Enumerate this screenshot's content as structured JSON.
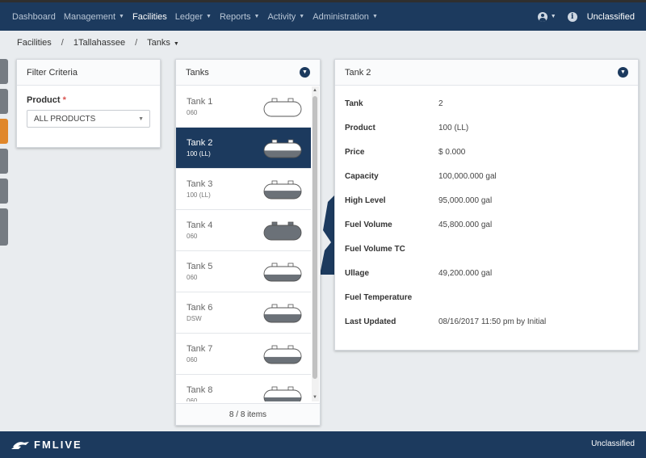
{
  "nav": {
    "items": [
      {
        "label": "Dashboard",
        "has_menu": false,
        "active": false
      },
      {
        "label": "Management",
        "has_menu": true,
        "active": false
      },
      {
        "label": "Facilities",
        "has_menu": false,
        "active": true
      },
      {
        "label": "Ledger",
        "has_menu": true,
        "active": false
      },
      {
        "label": "Reports",
        "has_menu": true,
        "active": false
      },
      {
        "label": "Activity",
        "has_menu": true,
        "active": false
      },
      {
        "label": "Administration",
        "has_menu": true,
        "active": false
      }
    ],
    "classification": "Unclassified"
  },
  "breadcrumb": {
    "items": [
      "Facilities",
      "1Tallahassee",
      "Tanks"
    ]
  },
  "filter": {
    "title": "Filter Criteria",
    "product_label": "Product",
    "required_mark": "*",
    "product_value": "ALL PRODUCTS"
  },
  "tanks": {
    "title": "Tanks",
    "items": [
      {
        "name": "Tank 1",
        "product": "060",
        "fill": 0.0,
        "selected": false
      },
      {
        "name": "Tank 2",
        "product": "100 (LL)",
        "fill": 0.48,
        "selected": true
      },
      {
        "name": "Tank 3",
        "product": "100 (LL)",
        "fill": 0.55,
        "selected": false
      },
      {
        "name": "Tank 4",
        "product": "060",
        "fill": 1.0,
        "selected": false
      },
      {
        "name": "Tank 5",
        "product": "060",
        "fill": 0.45,
        "selected": false
      },
      {
        "name": "Tank 6",
        "product": "DSW",
        "fill": 0.55,
        "selected": false
      },
      {
        "name": "Tank 7",
        "product": "060",
        "fill": 0.45,
        "selected": false
      },
      {
        "name": "Tank 8",
        "product": "060",
        "fill": 0.5,
        "selected": false
      }
    ],
    "footer": "8 / 8 items"
  },
  "detail": {
    "title": "Tank 2",
    "rows": [
      {
        "label": "Tank",
        "value": "2"
      },
      {
        "label": "Product",
        "value": "100 (LL)"
      },
      {
        "label": "Price",
        "value": " $ 0.000"
      },
      {
        "label": "Capacity",
        "value": "100,000.000 gal"
      },
      {
        "label": "High Level",
        "value": "95,000.000 gal"
      },
      {
        "label": "Fuel Volume",
        "value": "45,800.000 gal"
      },
      {
        "label": "Fuel Volume TC",
        "value": ""
      },
      {
        "label": "Ullage",
        "value": "49,200.000 gal"
      },
      {
        "label": "Fuel Temperature",
        "value": ""
      },
      {
        "label": "Last Updated",
        "value": "08/16/2017 11:50 pm by Initial"
      }
    ]
  },
  "footer": {
    "logo_text": "FMLIVE",
    "classification": "Unclassified"
  },
  "colors": {
    "navy": "#1c3a5e",
    "orange": "#e0872b",
    "tank_fill": "#6b7178"
  },
  "icons": [
    "user-icon",
    "info-icon",
    "chevron-down-icon",
    "tank-icon",
    "fmlive-logo-icon"
  ]
}
